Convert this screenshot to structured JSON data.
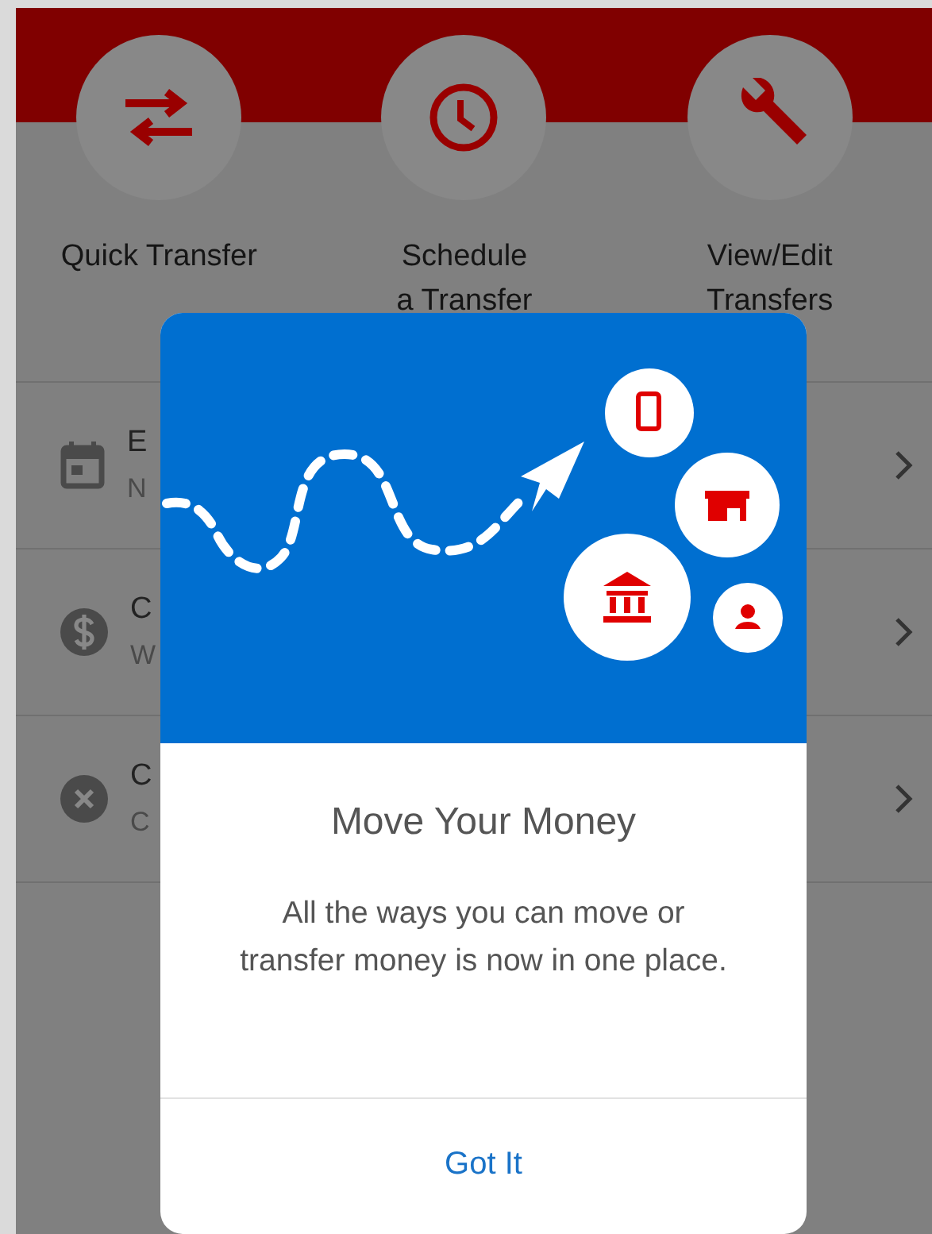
{
  "actions": [
    {
      "kind": "arrows",
      "lines": [
        "Quick Transfer"
      ]
    },
    {
      "kind": "clock",
      "lines": [
        "Schedule",
        "a Transfer"
      ]
    },
    {
      "kind": "wrench",
      "lines": [
        "View/Edit",
        "Transfers"
      ]
    }
  ],
  "rows": [
    {
      "kind": "calendar",
      "title": "E",
      "subtitle": "N"
    },
    {
      "kind": "dollar",
      "title": "C",
      "subtitle": "W"
    },
    {
      "kind": "cancel",
      "title": "C",
      "subtitle": "C"
    }
  ],
  "dialog": {
    "title": "Move Your Money",
    "body": "All the ways you can move or transfer money is now in one place.",
    "button": "Got It"
  }
}
